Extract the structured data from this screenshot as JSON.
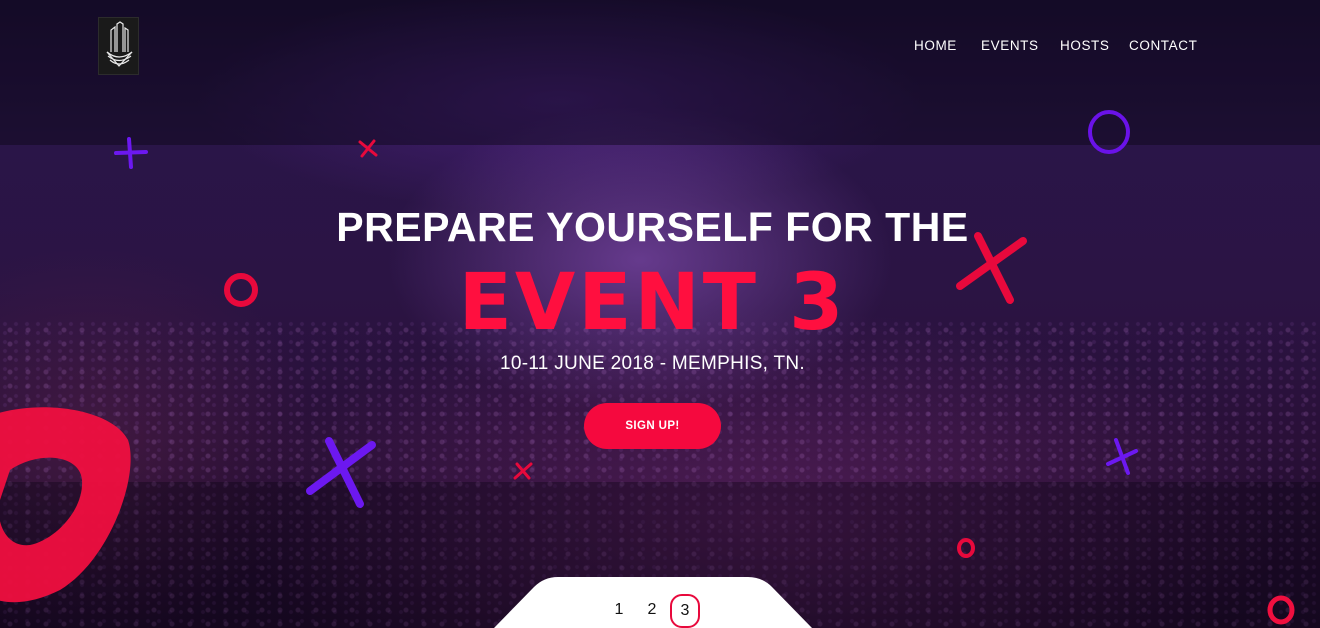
{
  "nav": {
    "items": [
      {
        "label": "HOME"
      },
      {
        "label": "EVENTS"
      },
      {
        "label": "HOSTS"
      },
      {
        "label": "CONTACT"
      }
    ]
  },
  "hero": {
    "headline": "PREPARE YOURSELF FOR THE",
    "event_title": "EVENT 3",
    "event_details": "10-11 JUNE 2018 - MEMPHIS, TN.",
    "cta_label": "SIGN UP!"
  },
  "slider": {
    "pages": [
      "1",
      "2",
      "3"
    ],
    "active_page": "3"
  },
  "colors": {
    "accent_red": "#ff0f3f",
    "accent_purple": "#6a12e8",
    "text": "#ffffff"
  },
  "icons": {
    "logo": "skyline-tower-logo-icon",
    "decorations": [
      "cross-icon",
      "ring-icon"
    ]
  }
}
